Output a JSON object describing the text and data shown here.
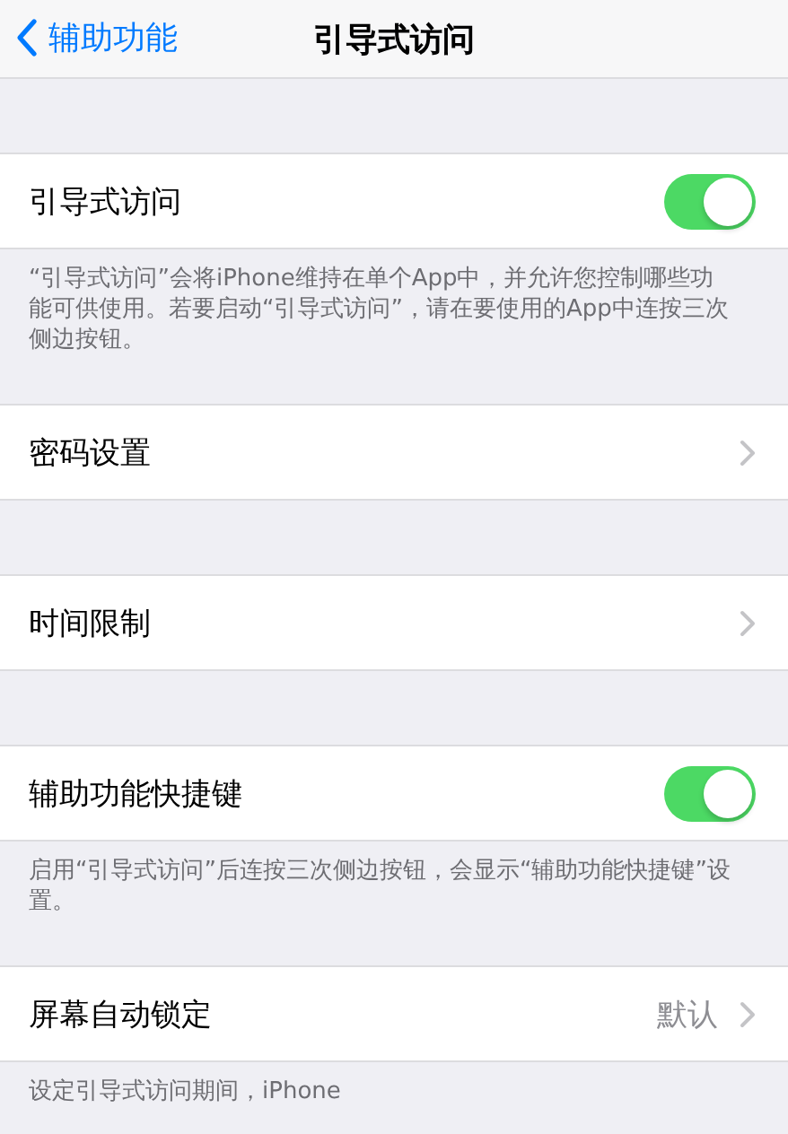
{
  "nav_bar": {
    "back_label": "辅助功能",
    "title": "引导式访问"
  },
  "sections": [
    {
      "rows": [
        {
          "kind": "toggle",
          "label": "引导式访问",
          "on": true
        }
      ],
      "footer": "“引导式访问”会将iPhone维持在单个App中，并允许您控制哪些功能可供使用。若要启动“引导式访问”，请在要使用的App中连按三次侧边按钮。"
    },
    {
      "rows": [
        {
          "kind": "link",
          "label": "密码设置"
        }
      ]
    },
    {
      "rows": [
        {
          "kind": "link",
          "label": "时间限制"
        }
      ]
    },
    {
      "rows": [
        {
          "kind": "toggle",
          "label": "辅助功能快捷键",
          "on": true
        }
      ],
      "footer": "启用“引导式访问”后连按三次侧边按钮，会显示“辅助功能快捷键”设置。"
    },
    {
      "rows": [
        {
          "kind": "link",
          "label": "屏幕自动锁定",
          "value": "默认"
        }
      ],
      "footer": "设定引导式访问期间，iPhone"
    }
  ]
}
